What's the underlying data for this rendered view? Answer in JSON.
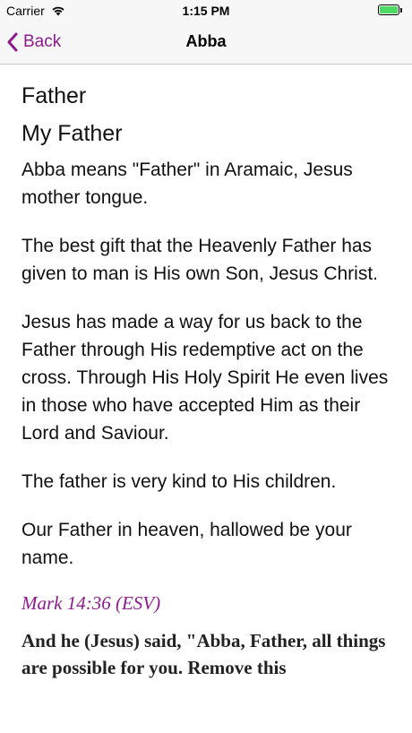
{
  "status_bar": {
    "carrier": "Carrier",
    "time": "1:15 PM",
    "wifi_icon": "wifi-icon",
    "battery_icon": "battery-icon",
    "battery_color": "#4cd964"
  },
  "nav": {
    "back_label": "Back",
    "title": "Abba",
    "accent": "#8e1b8e"
  },
  "content": {
    "heading1": "Father",
    "heading2": "My Father",
    "paragraphs": [
      "Abba means \"Father\" in Aramaic, Jesus mother tongue.",
      "The best gift that the Heavenly Father has given to man is His own Son, Jesus Christ.",
      "Jesus has made a way for us back to the Father through His redemptive act on the cross. Through His Holy Spirit He even lives in those who have accepted Him as their Lord and Saviour.",
      "The father is very kind to His children.",
      "Our Father in heaven, hallowed be your name."
    ],
    "reference": "Mark 14:36 (ESV)",
    "verse": "And he (Jesus) said, \"Abba, Father, all things are possible for you. Remove this"
  }
}
